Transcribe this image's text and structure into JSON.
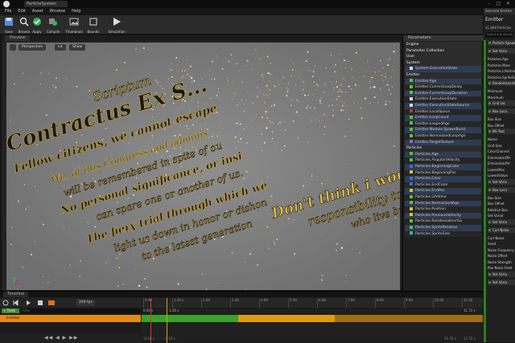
{
  "titlebar": {
    "tab": "ParticleSystem",
    "win_min": "–",
    "win_max": "□",
    "win_close": "✕"
  },
  "menu": [
    "File",
    "Edit",
    "Asset",
    "Window",
    "Help"
  ],
  "toolbar": {
    "items": [
      "Save",
      "Browse",
      "Apply",
      "Compile",
      "Thumbnail",
      "Bounds",
      "Simulation"
    ]
  },
  "viewport": {
    "tab": "Preview",
    "perspective": "Perspective",
    "lit": "Lit",
    "show": "Show",
    "script": [
      "Scriptum",
      "Contractus Ex S...",
      "Fellow citizens, we cannot escape",
      "We, of this Congress and adminis",
      "will be remembered in spite of ou",
      "No personal significance, or insi",
      "can spare one or another of us.",
      "The fiery trial through which we",
      "light us down in honor or dishon",
      "to the latest generation",
      "Don't think i would",
      "responsibility to",
      "who live by this"
    ]
  },
  "params": {
    "tab": "Parameters",
    "sections": [
      {
        "title": "Engine",
        "items": []
      },
      {
        "title": "Parameter Collection",
        "items": []
      },
      {
        "title": "User",
        "items": []
      },
      {
        "title": "System",
        "items": [
          {
            "label": "System.ExecutionState",
            "color": "#d8d8d8"
          }
        ]
      },
      {
        "title": "Emitter",
        "items": [
          {
            "label": "Emitter.Age",
            "color": "#5bc236"
          },
          {
            "label": "Emitter.CurrentLoopDelay",
            "color": "#5bc236"
          },
          {
            "label": "Emitter.CurrentLoopDuration",
            "color": "#5bc236"
          },
          {
            "label": "Emitter.ExecutionState",
            "color": "#d8d8d8"
          },
          {
            "label": "Emitter.ExecutionStateSource",
            "color": "#d8d8d8"
          },
          {
            "label": "Emitter.LocalSpace",
            "color": "#c23434"
          },
          {
            "label": "Emitter.LoopCount",
            "color": "#5bc236"
          },
          {
            "label": "Emitter.LoopedAge",
            "color": "#5bc236"
          },
          {
            "label": "Emitter.Module.SpawnBurst",
            "color": "#5bc236"
          },
          {
            "label": "Emitter.NormalizedLoopAge",
            "color": "#5bc236"
          },
          {
            "label": "Emitter.TargetTexture",
            "color": "#9a5ec9"
          }
        ]
      },
      {
        "title": "Particles",
        "items": [
          {
            "label": "Particles.Age",
            "color": "#5bc236"
          },
          {
            "label": "Particles.AngularVelocity",
            "color": "#5bc236"
          },
          {
            "label": "Particles.BeginningColor",
            "color": "#3a6cd6"
          },
          {
            "label": "Particles.BeginningPos",
            "color": "#d6c23a"
          },
          {
            "label": "Particles.Color",
            "color": "#3a6cd6"
          },
          {
            "label": "Particles.EndColor",
            "color": "#3a6cd6"
          },
          {
            "label": "Particles.EndPos",
            "color": "#d6c23a"
          },
          {
            "label": "Particles.Lifetime",
            "color": "#5bc236"
          },
          {
            "label": "Particles.NormalizedAge",
            "color": "#5bc236"
          },
          {
            "label": "Particles.Position",
            "color": "#d6c23a"
          },
          {
            "label": "Particles.PreviousVelocity",
            "color": "#d6c23a"
          },
          {
            "label": "Particles.RotationalInertia",
            "color": "#5bc236"
          },
          {
            "label": "Particles.SpriteRotation",
            "color": "#5bc236"
          },
          {
            "label": "Particles.SpriteSize",
            "color": "#3ab0a0"
          }
        ]
      }
    ]
  },
  "right": {
    "panel_tab": "Selected Emitter",
    "title": "Emitter",
    "count": "41,888 Particles",
    "search": "Search the details",
    "rows": [
      {
        "t": "Particle Spawn",
        "sec": true
      },
      {
        "t": "Set Varia",
        "sec": true
      },
      {
        "t": "Particles.Age"
      },
      {
        "t": "Particles.Mass"
      },
      {
        "t": "Particles.Lifetime"
      },
      {
        "t": "Particles.SpriteSiz"
      },
      {
        "t": "RandomLocation",
        "sec": true
      },
      {
        "t": "Minimum"
      },
      {
        "t": "Maximum"
      },
      {
        "t": "Grid Loc",
        "sec": true
      },
      {
        "t": "Box Loca",
        "sec": true
      },
      {
        "t": "Box Size"
      },
      {
        "t": "Box Offset"
      },
      {
        "t": "NS Text",
        "sec": true
      },
      {
        "t": "Name"
      },
      {
        "t": "Grid Size"
      },
      {
        "t": "ColorChannel"
      },
      {
        "t": "EliminateLiftH"
      },
      {
        "t": "EliminateLiftV"
      },
      {
        "t": "LowestPos"
      },
      {
        "t": "LowestValue"
      },
      {
        "t": "Set Varia",
        "sec": true
      },
      {
        "t": "Box Loca",
        "sec": true
      },
      {
        "t": "Box Size"
      },
      {
        "t": "Box Offset"
      },
      {
        "t": "Relative Box"
      },
      {
        "t": "Set Variat"
      },
      {
        "t": "Set Varia",
        "sec": true
      },
      {
        "t": "Curl Noise",
        "sec": true
      },
      {
        "t": "Curl Noise"
      },
      {
        "t": "Seed"
      },
      {
        "t": "Noise Frequency"
      },
      {
        "t": "Noise Offset"
      },
      {
        "t": "Noise Strength"
      },
      {
        "t": "Pan Noise Field"
      },
      {
        "t": "Set Varia",
        "sec": true
      },
      {
        "t": "Set Varia",
        "sec": true
      }
    ]
  },
  "timeline": {
    "tab": "Timeline",
    "fps": "240 fps",
    "track_btn": "+ Track",
    "filter": "Filter",
    "track_name": "Emitter",
    "start": "0.00 s",
    "playhead": "1.26 s",
    "end": "11.72 s",
    "ticks": [
      "0.40",
      "1.26 s",
      "2.00",
      "3.00",
      "4.00",
      "5.00",
      "6.00",
      "7.00",
      "8.00",
      "9.00",
      "10.00",
      "11.00"
    ],
    "bottom_left": "-0.10 s",
    "bottom_left2": "-0.10 s",
    "bottom_right": "11.72 s",
    "bottom_right2": "12.72 s"
  }
}
